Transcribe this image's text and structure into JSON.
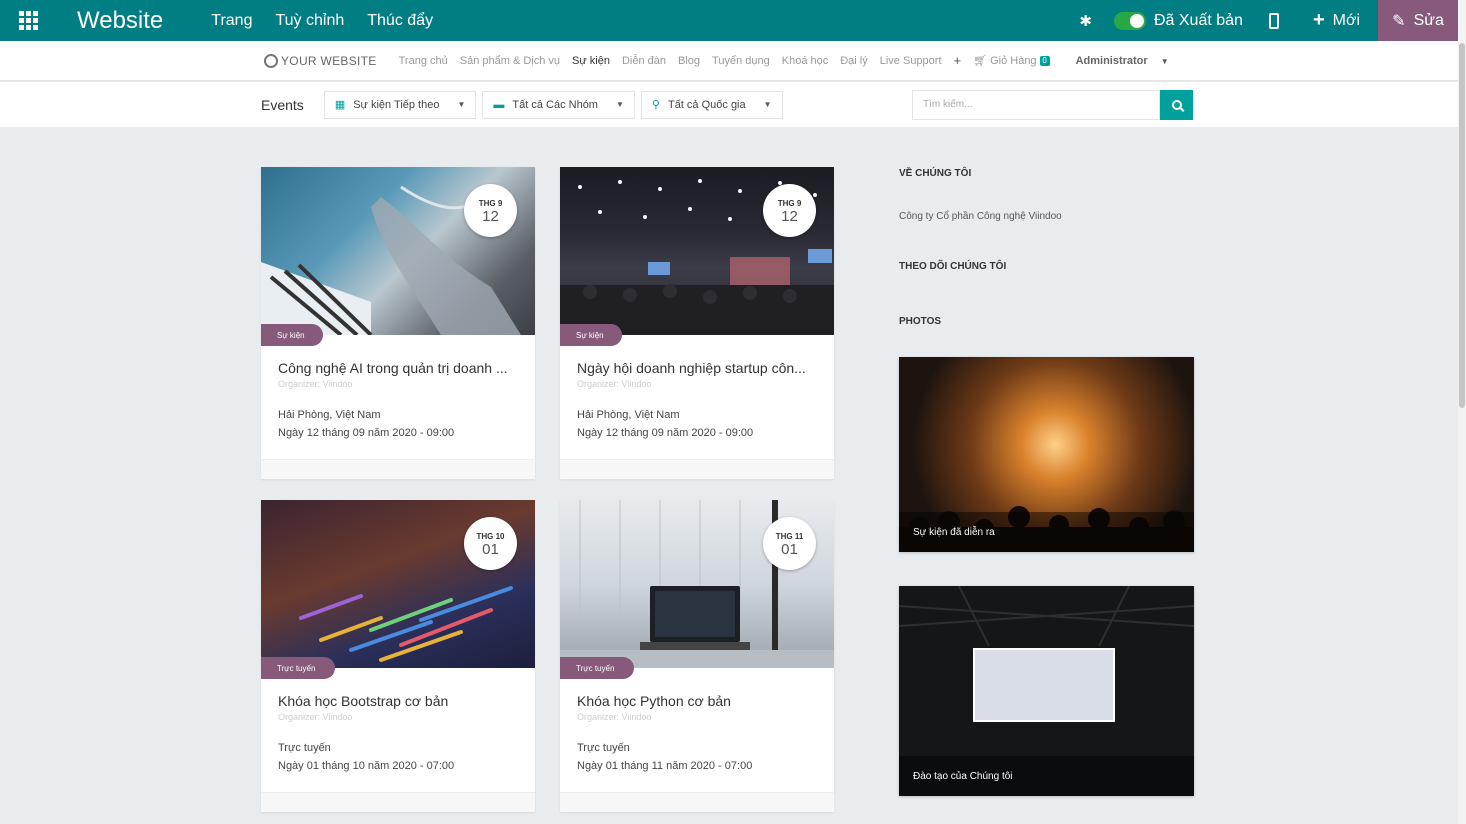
{
  "topbar": {
    "brand": "Website",
    "menu": [
      "Trang",
      "Tuỳ chỉnh",
      "Thúc đẩy"
    ],
    "publish_label": "Đã Xuất bản",
    "new_label": "Mới",
    "edit_label": "Sửa"
  },
  "sitenav": {
    "logo": "YOUR WEBSITE",
    "items": [
      "Trang chủ",
      "Sản phẩm & Dịch vụ",
      "Sự kiện",
      "Diễn đàn",
      "Blog",
      "Tuyển dụng",
      "Khoá học",
      "Đại lý",
      "Live Support"
    ],
    "active": "Sự kiện",
    "cart_label": "Giỏ Hàng",
    "cart_count": "0",
    "user": "Administrator"
  },
  "filters": {
    "title": "Events",
    "upcoming": "Sự kiện Tiếp theo",
    "groups": "Tất cả Các Nhóm",
    "countries": "Tất cả Quốc gia",
    "search_placeholder": "Tìm kiếm..."
  },
  "events": [
    {
      "month": "THG 9",
      "day": "12",
      "tag": "Sự kiện",
      "title": "Công nghệ AI trong quản trị doanh ...",
      "organizer": "Organizer: Viindoo",
      "location": "Hải Phòng, Việt Nam",
      "date": "Ngày 12 tháng 09 năm 2020 - 09:00"
    },
    {
      "month": "THG 9",
      "day": "12",
      "tag": "Sự kiện",
      "title": "Ngày hội doanh nghiệp startup côn...",
      "organizer": "Organizer: Viindoo",
      "location": "Hải Phòng, Việt Nam",
      "date": "Ngày 12 tháng 09 năm 2020 - 09:00"
    },
    {
      "month": "THG 10",
      "day": "01",
      "tag": "Trực tuyến",
      "title": "Khóa học Bootstrap cơ bản",
      "organizer": "Organizer: Viindoo",
      "location": "Trực tuyến",
      "date": "Ngày 01 tháng 10 năm 2020 - 07:00"
    },
    {
      "month": "THG 11",
      "day": "01",
      "tag": "Trực tuyến",
      "title": "Khóa học Python cơ bản",
      "organizer": "Organizer: Viindoo",
      "location": "Trực tuyến",
      "date": "Ngày 01 tháng 11 năm 2020 - 07:00"
    }
  ],
  "sidebar": {
    "about_heading": "VỀ CHÚNG TÔI",
    "about_text": "Công ty Cổ phần Công nghệ Viindoo",
    "follow_heading": "THEO DÕI CHÚNG TÔI",
    "photos_heading": "PHOTOS",
    "photos": [
      {
        "caption": "Sự kiện đã diễn ra"
      },
      {
        "caption": "Đào tạo của Chúng tôi"
      }
    ]
  }
}
